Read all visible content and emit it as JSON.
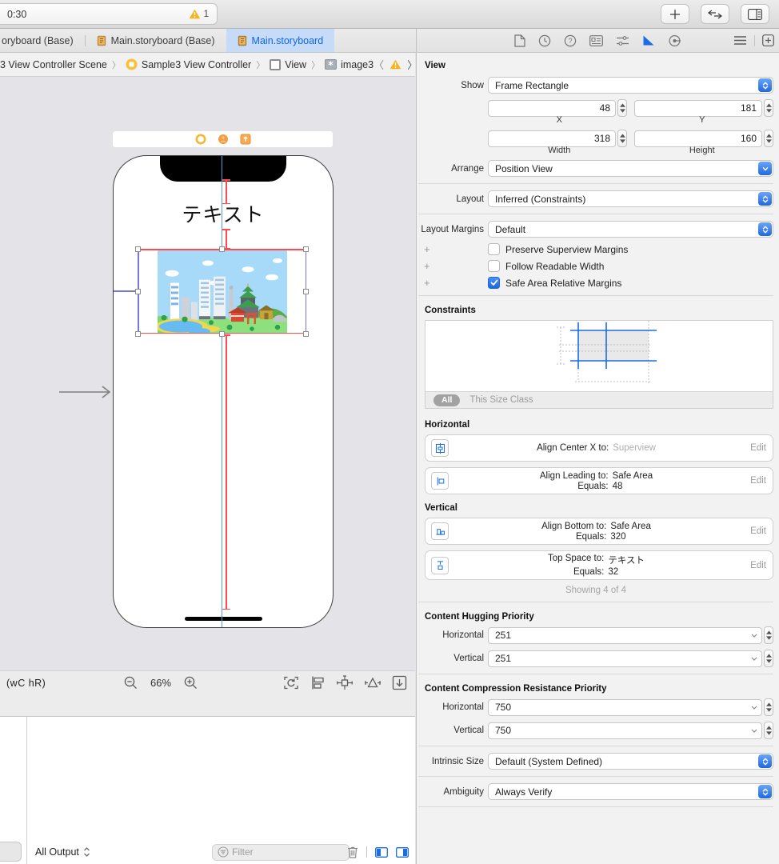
{
  "toolbar": {
    "activity_time": "0:30",
    "warning_count": "1"
  },
  "tabs": {
    "tab1": "oryboard (Base)",
    "tab2": "Main.storyboard (Base)",
    "tab3": "Main.storyboard"
  },
  "jump_bar": {
    "scene": "3 View Controller Scene",
    "controller": "Sample3 View Controller",
    "view": "View",
    "image": "image3"
  },
  "canvas": {
    "device_text": "テキスト",
    "size_class": "(wC hR)",
    "zoom_level": "66%"
  },
  "inspector": {
    "title": "View",
    "show_label": "Show",
    "show_value": "Frame Rectangle",
    "x_value": "48",
    "y_value": "181",
    "x_label": "X",
    "y_label": "Y",
    "width_value": "318",
    "height_value": "160",
    "width_label": "Width",
    "height_label": "Height",
    "arrange_label": "Arrange",
    "arrange_value": "Position View",
    "layout_label": "Layout",
    "layout_value": "Inferred (Constraints)",
    "margins_label": "Layout Margins",
    "margins_value": "Default",
    "checkboxes": [
      {
        "label": "Preserve Superview Margins",
        "checked": false
      },
      {
        "label": "Follow Readable Width",
        "checked": false
      },
      {
        "label": "Safe Area Relative Margins",
        "checked": true
      }
    ],
    "constraints_header": "Constraints",
    "all_label": "All",
    "size_class_label": "This Size Class",
    "horizontal_header": "Horizontal",
    "vertical_header": "Vertical",
    "edit_label": "Edit",
    "rows": [
      {
        "l1": "Align Center X to:",
        "v1": "Superview",
        "l2": "",
        "v2": ""
      },
      {
        "l1": "Align Leading to:",
        "v1": "Safe Area",
        "l2": "Equals:",
        "v2": "48"
      },
      {
        "l1": "Align Bottom to:",
        "v1": "Safe Area",
        "l2": "Equals:",
        "v2": "320"
      },
      {
        "l1": "Top Space to:",
        "v1": "テキスト",
        "l2": "Equals:",
        "v2": "32"
      }
    ],
    "showing": "Showing 4 of 4",
    "hugging_header": "Content Hugging Priority",
    "compression_header": "Content Compression Resistance Priority",
    "horizontal_label": "Horizontal",
    "vertical_label": "Vertical",
    "hugging_horizontal": "251",
    "hugging_vertical": "251",
    "compression_horizontal": "750",
    "compression_vertical": "750",
    "intrinsic_label": "Intrinsic Size",
    "intrinsic_value": "Default (System Defined)",
    "ambiguity_label": "Ambiguity",
    "ambiguity_value": "Always Verify"
  },
  "console": {
    "output_label": "All Output",
    "filter_placeholder": "Filter"
  },
  "colors": {
    "accent_blue": "#1a6de3",
    "selection_red": "#fd4b50",
    "selection_purple": "#7577dd",
    "warning_orange": "#f5a623",
    "tab_selected": "#c5dbf8"
  }
}
